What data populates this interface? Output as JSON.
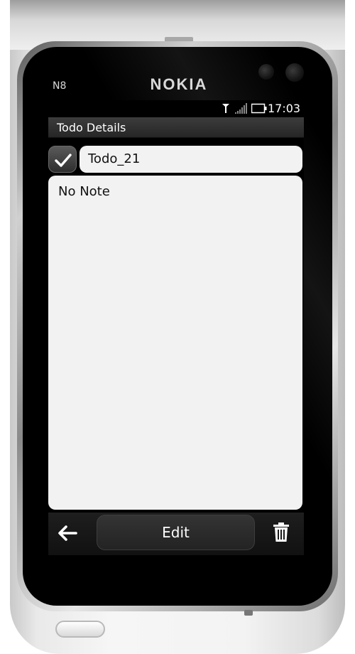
{
  "device": {
    "model": "N8",
    "brand": "NOKIA"
  },
  "status_bar": {
    "time": "17:03",
    "antenna_icon": "antenna-icon",
    "signal_icon": "signal-strength-icon",
    "battery_icon": "battery-icon"
  },
  "header": {
    "title": "Todo Details"
  },
  "todo": {
    "name": "Todo_21",
    "completed": true,
    "note": "No Note"
  },
  "toolbar": {
    "back_icon": "back-arrow-icon",
    "edit_label": "Edit",
    "delete_icon": "trash-icon"
  }
}
